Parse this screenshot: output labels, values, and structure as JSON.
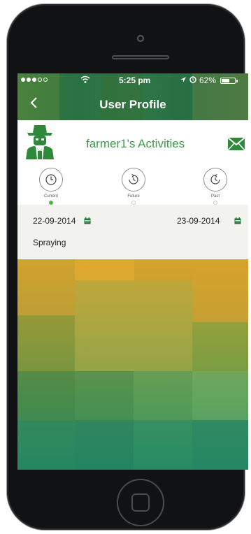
{
  "status_bar": {
    "time": "5:25 pm",
    "battery_percent": "62%",
    "battery_level": 0.62
  },
  "header": {
    "title": "User Profile"
  },
  "profile": {
    "activities_title": "farmer1's Activities"
  },
  "tabs": [
    {
      "label": "Current",
      "active": true
    },
    {
      "label": "Future",
      "active": false
    },
    {
      "label": "Past",
      "active": false
    }
  ],
  "activity": {
    "start_date": "22-09-2014",
    "end_date": "23-09-2014",
    "name": "Spraying"
  },
  "colors": {
    "accent_green": "#3d9a4a",
    "active_dot": "#58b04a",
    "date_bar_bg": "#f2f2ee"
  }
}
